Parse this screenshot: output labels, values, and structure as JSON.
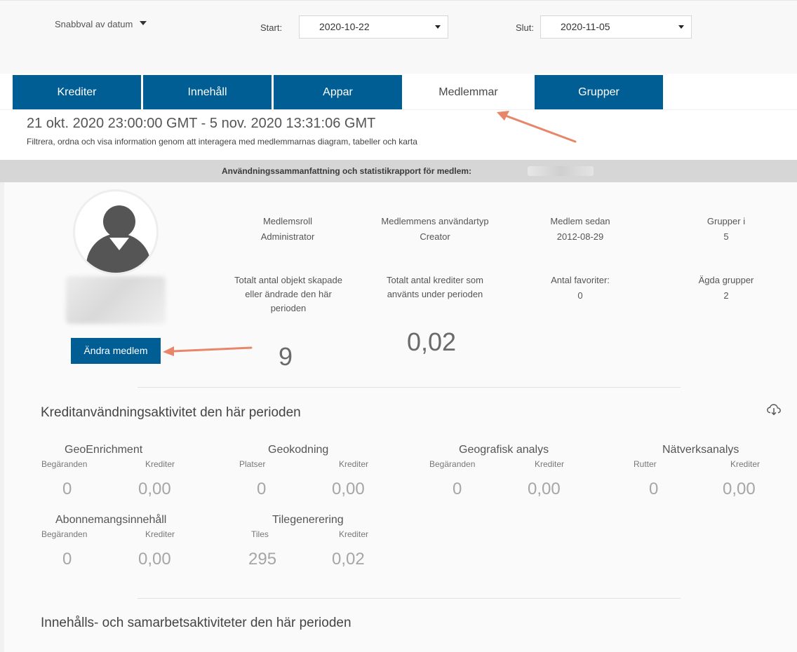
{
  "filters": {
    "quick_select": "Snabbval av datum",
    "start_label": "Start:",
    "start_value": "2020-10-22",
    "end_label": "Slut:",
    "end_value": "2020-11-05"
  },
  "tabs": [
    {
      "label": "Krediter"
    },
    {
      "label": "Innehåll"
    },
    {
      "label": "Appar"
    },
    {
      "label": "Medlemmar"
    },
    {
      "label": "Grupper"
    }
  ],
  "header": {
    "range": "21 okt. 2020 23:00:00 GMT - 5 nov. 2020 13:31:06 GMT",
    "subtitle": "Filtrera, ordna och visa information genom att interagera med medlemmarnas diagram, tabeller och karta"
  },
  "strip": {
    "text": "Användningssammanfattning och statistikrapport för medlem:"
  },
  "member": {
    "edit_button": "Ändra medlem",
    "role_label": "Medlemsroll",
    "role_value": "Administrator",
    "usertype_label": "Medlemmens användartyp",
    "usertype_value": "Creator",
    "since_label": "Medlem sedan",
    "since_value": "2012-08-29",
    "groups_label": "Grupper i",
    "groups_value": "5",
    "objects_label_1": "Totalt antal objekt skapade",
    "objects_label_2": "eller ändrade den här",
    "objects_label_3": "perioden",
    "objects_value": "9",
    "credits_label_1": "Totalt antal krediter som",
    "credits_label_2": "använts under perioden",
    "credits_value": "0,02",
    "favorites_label": "Antal favoriter:",
    "favorites_value": "0",
    "owned_label": "Ägda grupper",
    "owned_value": "2"
  },
  "credit_section": {
    "title": "Kreditanvändningsaktivitet den här perioden",
    "groups": [
      {
        "title": "GeoEnrichment",
        "label_a": "Begäranden",
        "label_b": "Krediter",
        "value_a": "0",
        "value_b": "0,00"
      },
      {
        "title": "Geokodning",
        "label_a": "Platser",
        "label_b": "Krediter",
        "value_a": "0",
        "value_b": "0,00"
      },
      {
        "title": "Geografisk analys",
        "label_a": "Begäranden",
        "label_b": "Krediter",
        "value_a": "0",
        "value_b": "0,00"
      },
      {
        "title": "Nätverksanalys",
        "label_a": "Rutter",
        "label_b": "Krediter",
        "value_a": "0",
        "value_b": "0,00"
      },
      {
        "title": "Abonnemangsinnehåll",
        "label_a": "Begäranden",
        "label_b": "Krediter",
        "value_a": "0",
        "value_b": "0,00"
      },
      {
        "title": "Tilegenerering",
        "label_a": "Tiles",
        "label_b": "Krediter",
        "value_a": "295",
        "value_b": "0,02"
      }
    ]
  },
  "content_section": {
    "title": "Innehålls- och samarbetsaktiviteter den här perioden"
  },
  "icons": {
    "download": "cloud-download-icon",
    "avatar": "user-avatar-icon",
    "dropdown": "caret-down-icon"
  },
  "colors": {
    "tab_blue": "#005e95",
    "arrow": "#e8866a",
    "strip": "#d6d6d6"
  }
}
